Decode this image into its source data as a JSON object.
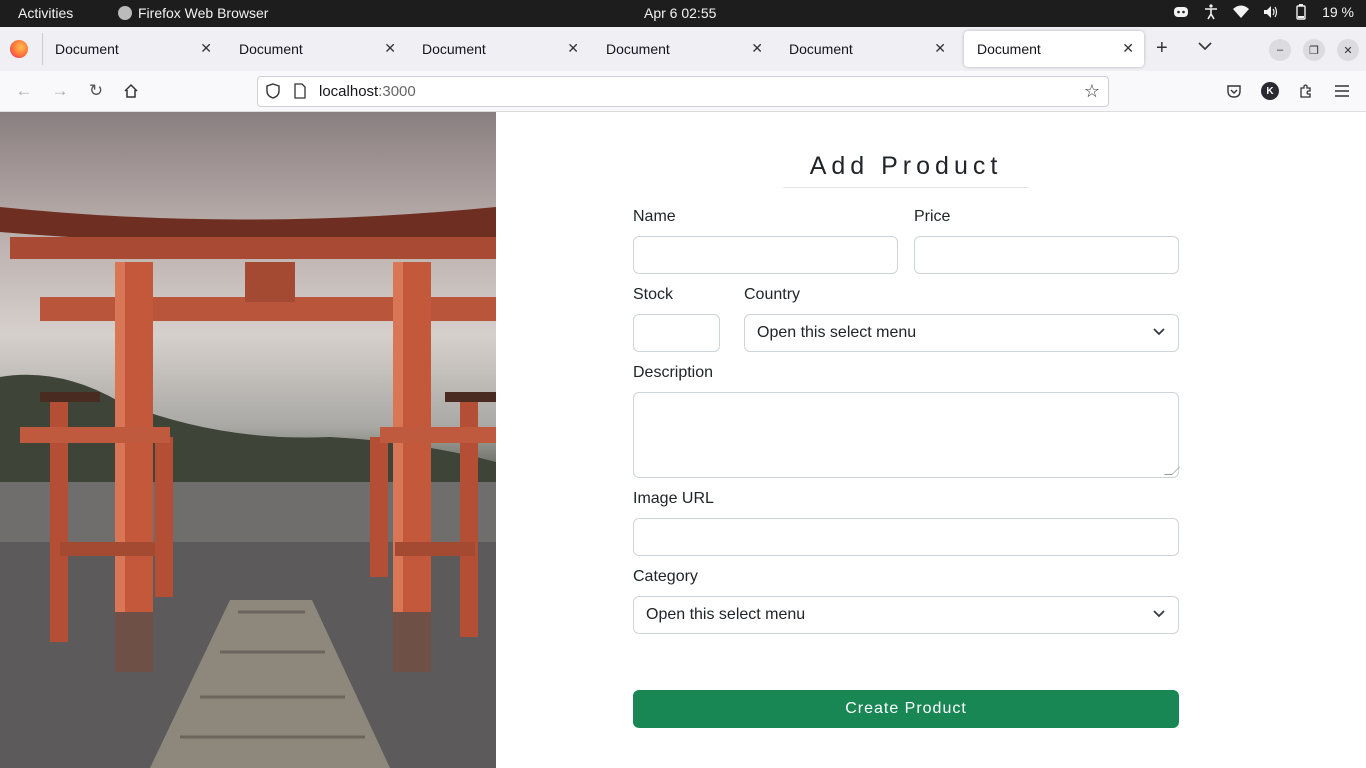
{
  "topbar": {
    "activities": "Activities",
    "app_name": "Firefox Web Browser",
    "clock": "Apr 6  02:55",
    "battery": "19 %"
  },
  "tabs": [
    {
      "label": "Document",
      "active": false
    },
    {
      "label": "Document",
      "active": false
    },
    {
      "label": "Document",
      "active": false
    },
    {
      "label": "Document",
      "active": false
    },
    {
      "label": "Document",
      "active": false
    },
    {
      "label": "Document",
      "active": true
    }
  ],
  "urlbar": {
    "host": "localhost",
    "port": ":3000"
  },
  "account_initial": "K",
  "form": {
    "title": "Add Product",
    "name_label": "Name",
    "price_label": "Price",
    "stock_label": "Stock",
    "country_label": "Country",
    "country_select": "Open this select menu",
    "description_label": "Description",
    "image_url_label": "Image URL",
    "category_label": "Category",
    "category_select": "Open this select menu",
    "submit_label": "Create Product"
  },
  "colors": {
    "primary_button": "#198754",
    "torii": "#c4583a"
  }
}
